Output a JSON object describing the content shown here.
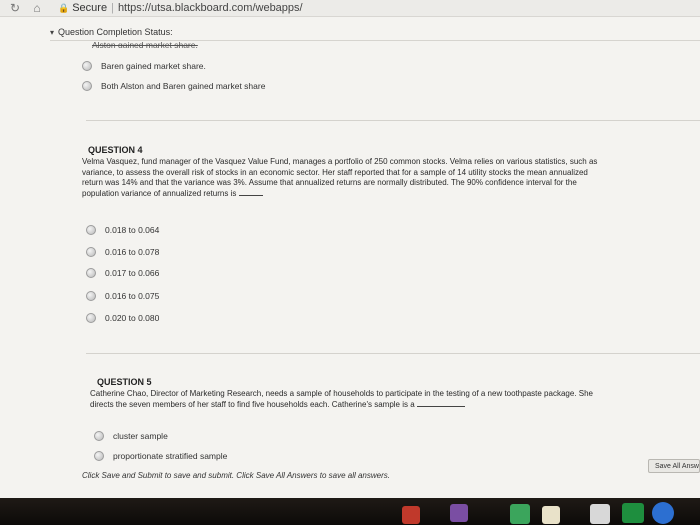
{
  "browser": {
    "secure_label": "Secure",
    "url": "https://utsa.blackboard.com/webapps/"
  },
  "status": {
    "label": "Question Completion Status:"
  },
  "prev_question": {
    "cut_answer": "Alston gained market share.",
    "answers": [
      "Baren gained market share.",
      "Both Alston and Baren gained market share"
    ]
  },
  "q4": {
    "title": "QUESTION 4",
    "lines": [
      "Velma Vasquez, fund manager of the Vasquez Value Fund, manages a portfolio of 250 common stocks. Velma relies on various statistics, such as",
      "variance, to assess the overall risk of stocks in an economic sector. Her staff reported that for a sample of 14 utility stocks the mean annualized",
      "return was 14% and that the variance was 3%. Assume that annualized returns are normally distributed. The 90% confidence interval for the",
      "population variance of annualized returns is"
    ],
    "answers": [
      "0.018 to 0.064",
      "0.016 to 0.078",
      "0.017 to 0.066",
      "0.016 to 0.075",
      "0.020 to 0.080"
    ]
  },
  "q5": {
    "title": "QUESTION 5",
    "lines": [
      "Catherine Chao, Director of Marketing Research, needs a sample of households to participate in the testing of a new toothpaste package. She",
      "directs the seven members of her staff to find five households each. Catherine's sample is a"
    ],
    "answers": [
      "cluster sample",
      "proportionate stratified sample"
    ]
  },
  "footer": {
    "instruction": "Click Save and Submit to save and submit. Click Save All Answers to save all answers.",
    "save_all_label": "Save All Answers"
  }
}
